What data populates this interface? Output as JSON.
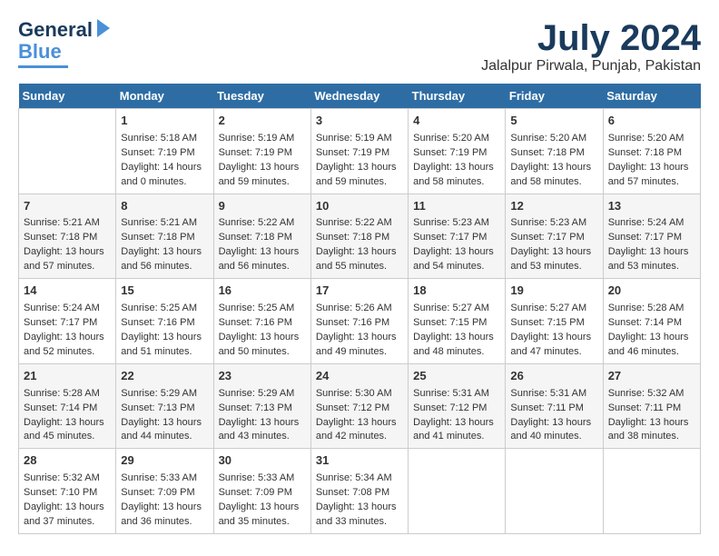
{
  "header": {
    "logo_general": "General",
    "logo_blue": "Blue",
    "month": "July 2024",
    "location": "Jalalpur Pirwala, Punjab, Pakistan"
  },
  "days_of_week": [
    "Sunday",
    "Monday",
    "Tuesday",
    "Wednesday",
    "Thursday",
    "Friday",
    "Saturday"
  ],
  "weeks": [
    [
      {
        "day": "",
        "info": ""
      },
      {
        "day": "1",
        "info": "Sunrise: 5:18 AM\nSunset: 7:19 PM\nDaylight: 14 hours\nand 0 minutes."
      },
      {
        "day": "2",
        "info": "Sunrise: 5:19 AM\nSunset: 7:19 PM\nDaylight: 13 hours\nand 59 minutes."
      },
      {
        "day": "3",
        "info": "Sunrise: 5:19 AM\nSunset: 7:19 PM\nDaylight: 13 hours\nand 59 minutes."
      },
      {
        "day": "4",
        "info": "Sunrise: 5:20 AM\nSunset: 7:19 PM\nDaylight: 13 hours\nand 58 minutes."
      },
      {
        "day": "5",
        "info": "Sunrise: 5:20 AM\nSunset: 7:18 PM\nDaylight: 13 hours\nand 58 minutes."
      },
      {
        "day": "6",
        "info": "Sunrise: 5:20 AM\nSunset: 7:18 PM\nDaylight: 13 hours\nand 57 minutes."
      }
    ],
    [
      {
        "day": "7",
        "info": "Sunrise: 5:21 AM\nSunset: 7:18 PM\nDaylight: 13 hours\nand 57 minutes."
      },
      {
        "day": "8",
        "info": "Sunrise: 5:21 AM\nSunset: 7:18 PM\nDaylight: 13 hours\nand 56 minutes."
      },
      {
        "day": "9",
        "info": "Sunrise: 5:22 AM\nSunset: 7:18 PM\nDaylight: 13 hours\nand 56 minutes."
      },
      {
        "day": "10",
        "info": "Sunrise: 5:22 AM\nSunset: 7:18 PM\nDaylight: 13 hours\nand 55 minutes."
      },
      {
        "day": "11",
        "info": "Sunrise: 5:23 AM\nSunset: 7:17 PM\nDaylight: 13 hours\nand 54 minutes."
      },
      {
        "day": "12",
        "info": "Sunrise: 5:23 AM\nSunset: 7:17 PM\nDaylight: 13 hours\nand 53 minutes."
      },
      {
        "day": "13",
        "info": "Sunrise: 5:24 AM\nSunset: 7:17 PM\nDaylight: 13 hours\nand 53 minutes."
      }
    ],
    [
      {
        "day": "14",
        "info": "Sunrise: 5:24 AM\nSunset: 7:17 PM\nDaylight: 13 hours\nand 52 minutes."
      },
      {
        "day": "15",
        "info": "Sunrise: 5:25 AM\nSunset: 7:16 PM\nDaylight: 13 hours\nand 51 minutes."
      },
      {
        "day": "16",
        "info": "Sunrise: 5:25 AM\nSunset: 7:16 PM\nDaylight: 13 hours\nand 50 minutes."
      },
      {
        "day": "17",
        "info": "Sunrise: 5:26 AM\nSunset: 7:16 PM\nDaylight: 13 hours\nand 49 minutes."
      },
      {
        "day": "18",
        "info": "Sunrise: 5:27 AM\nSunset: 7:15 PM\nDaylight: 13 hours\nand 48 minutes."
      },
      {
        "day": "19",
        "info": "Sunrise: 5:27 AM\nSunset: 7:15 PM\nDaylight: 13 hours\nand 47 minutes."
      },
      {
        "day": "20",
        "info": "Sunrise: 5:28 AM\nSunset: 7:14 PM\nDaylight: 13 hours\nand 46 minutes."
      }
    ],
    [
      {
        "day": "21",
        "info": "Sunrise: 5:28 AM\nSunset: 7:14 PM\nDaylight: 13 hours\nand 45 minutes."
      },
      {
        "day": "22",
        "info": "Sunrise: 5:29 AM\nSunset: 7:13 PM\nDaylight: 13 hours\nand 44 minutes."
      },
      {
        "day": "23",
        "info": "Sunrise: 5:29 AM\nSunset: 7:13 PM\nDaylight: 13 hours\nand 43 minutes."
      },
      {
        "day": "24",
        "info": "Sunrise: 5:30 AM\nSunset: 7:12 PM\nDaylight: 13 hours\nand 42 minutes."
      },
      {
        "day": "25",
        "info": "Sunrise: 5:31 AM\nSunset: 7:12 PM\nDaylight: 13 hours\nand 41 minutes."
      },
      {
        "day": "26",
        "info": "Sunrise: 5:31 AM\nSunset: 7:11 PM\nDaylight: 13 hours\nand 40 minutes."
      },
      {
        "day": "27",
        "info": "Sunrise: 5:32 AM\nSunset: 7:11 PM\nDaylight: 13 hours\nand 38 minutes."
      }
    ],
    [
      {
        "day": "28",
        "info": "Sunrise: 5:32 AM\nSunset: 7:10 PM\nDaylight: 13 hours\nand 37 minutes."
      },
      {
        "day": "29",
        "info": "Sunrise: 5:33 AM\nSunset: 7:09 PM\nDaylight: 13 hours\nand 36 minutes."
      },
      {
        "day": "30",
        "info": "Sunrise: 5:33 AM\nSunset: 7:09 PM\nDaylight: 13 hours\nand 35 minutes."
      },
      {
        "day": "31",
        "info": "Sunrise: 5:34 AM\nSunset: 7:08 PM\nDaylight: 13 hours\nand 33 minutes."
      },
      {
        "day": "",
        "info": ""
      },
      {
        "day": "",
        "info": ""
      },
      {
        "day": "",
        "info": ""
      }
    ]
  ]
}
